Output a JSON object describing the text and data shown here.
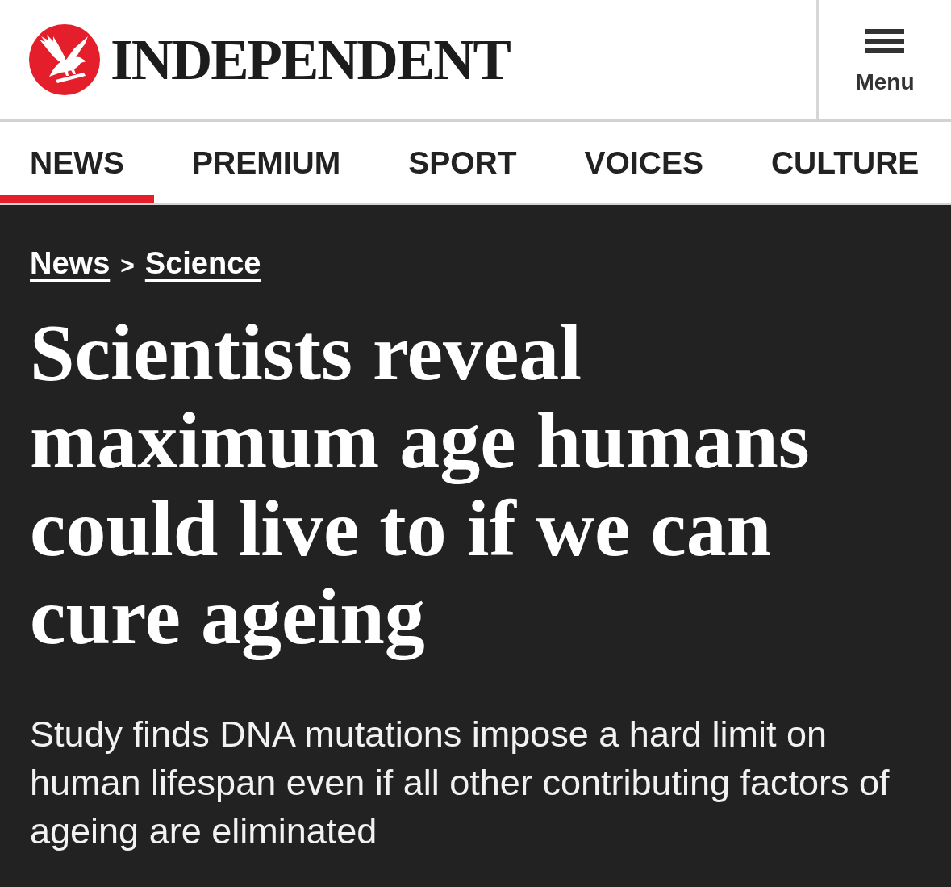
{
  "header": {
    "wordmark": "INDEPENDENT",
    "menu_button": {
      "label": "Menu"
    }
  },
  "nav": {
    "tabs": [
      {
        "label": "NEWS",
        "selected": true
      },
      {
        "label": "PREMIUM",
        "selected": false
      },
      {
        "label": "SPORT",
        "selected": false
      },
      {
        "label": "VOICES",
        "selected": false
      },
      {
        "label": "CULTURE",
        "selected": false
      }
    ]
  },
  "article": {
    "breadcrumb": {
      "links": [
        "News",
        "Science"
      ],
      "separator": ">"
    },
    "headline": "Scientists reveal maximum age humans could live to if we can cure ageing",
    "standfirst": "Study finds DNA mutations impose a hard limit on human lifespan even if all other contributing factors of ageing are eliminated"
  }
}
